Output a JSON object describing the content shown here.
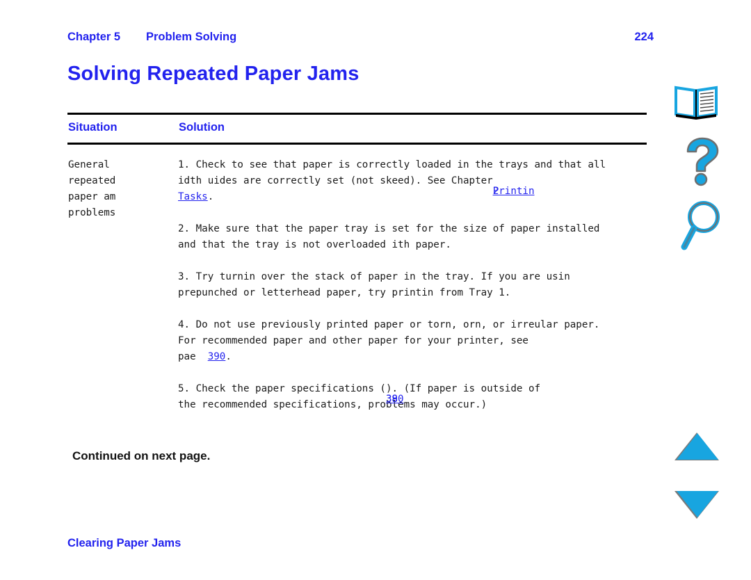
{
  "header": {
    "chapter": "Chapter 5",
    "section": "Problem Solving",
    "page_number": "224"
  },
  "title": "Solving Repeated Paper Jams",
  "table": {
    "columns": [
      "Situation",
      "Solution"
    ],
    "situation": "General\nrepeated\npaper am\nproblems",
    "steps": [
      {
        "id": "step-1",
        "line1": "1. Check to see that paper is correctly loaded in the trays and that all",
        "line2_pre": "idth uides are correctly set (not skeed). See Chapter",
        "link_overlap_a": "2",
        "link_overlap_b": "Printin",
        "line3_link": "Tasks",
        "line3_post": "."
      },
      {
        "id": "step-2",
        "line1": "2. Make sure that the paper tray is set for the size of paper installed",
        "line2": "and that the tray is not overloaded ith paper."
      },
      {
        "id": "step-3",
        "line1": "3. Try turnin over the stack of paper in the tray. If you are usin",
        "line2": "prepunched or letterhead paper, try printin from Tray 1."
      },
      {
        "id": "step-4",
        "line1": "4. Do not use previously printed paper or torn, orn, or irreular paper.",
        "line2": "For recommended paper and other paper for your printer, see",
        "line3_pre": "pae  ",
        "line3_link": "390",
        "line3_post": "."
      },
      {
        "id": "step-5",
        "line1_pre": "5. Check the paper specifications (",
        "line1_link_a": "390",
        "line1_link_b": "38",
        "line1_post": "). (If paper is outside of",
        "line2": "the recommended specifications, problems may occur.)"
      }
    ]
  },
  "continued_note": "Continued on next page.",
  "footer_link": "Clearing Paper Jams",
  "icons": {
    "book": "book-icon",
    "help": "question-mark-icon",
    "find": "magnifier-icon",
    "up": "triangle-up-icon",
    "down": "triangle-down-icon"
  },
  "colors": {
    "link_blue": "#2222ee",
    "icon_cyan": "#18a5e0",
    "icon_shadow": "#7a7a7a",
    "text": "#1a1a1a"
  }
}
